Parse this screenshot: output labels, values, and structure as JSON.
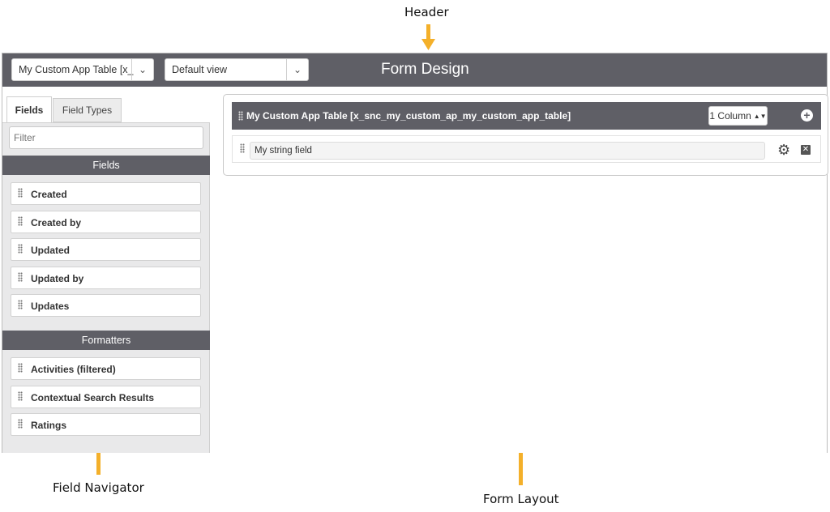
{
  "annotations": {
    "header": "Header",
    "field_navigator": "Field Navigator",
    "form_layout": "Form Layout",
    "arrow_color": "#f4b02a"
  },
  "header": {
    "table_select": "My Custom App Table [x_s",
    "view_select": "Default view",
    "title": "Form Design",
    "bg_color": "#5f5f66"
  },
  "navigator": {
    "tabs": [
      {
        "label": "Fields",
        "active": true
      },
      {
        "label": "Field Types",
        "active": false
      }
    ],
    "filter_placeholder": "Filter",
    "fields_heading": "Fields",
    "fields": [
      "Created",
      "Created by",
      "Updated",
      "Updated by",
      "Updates"
    ],
    "formatters_heading": "Formatters",
    "formatters": [
      "Activities (filtered)",
      "Contextual Search Results",
      "Ratings"
    ]
  },
  "layout": {
    "section_title": "My Custom App Table [x_snc_my_custom_ap_my_custom_app_table]",
    "columns_select": "1 Column",
    "field_label": "My string field",
    "icons": {
      "add": "plus-circle-icon",
      "settings": "gear-icon",
      "remove": "close-box-icon",
      "drag": "drag-handle-icon"
    }
  }
}
